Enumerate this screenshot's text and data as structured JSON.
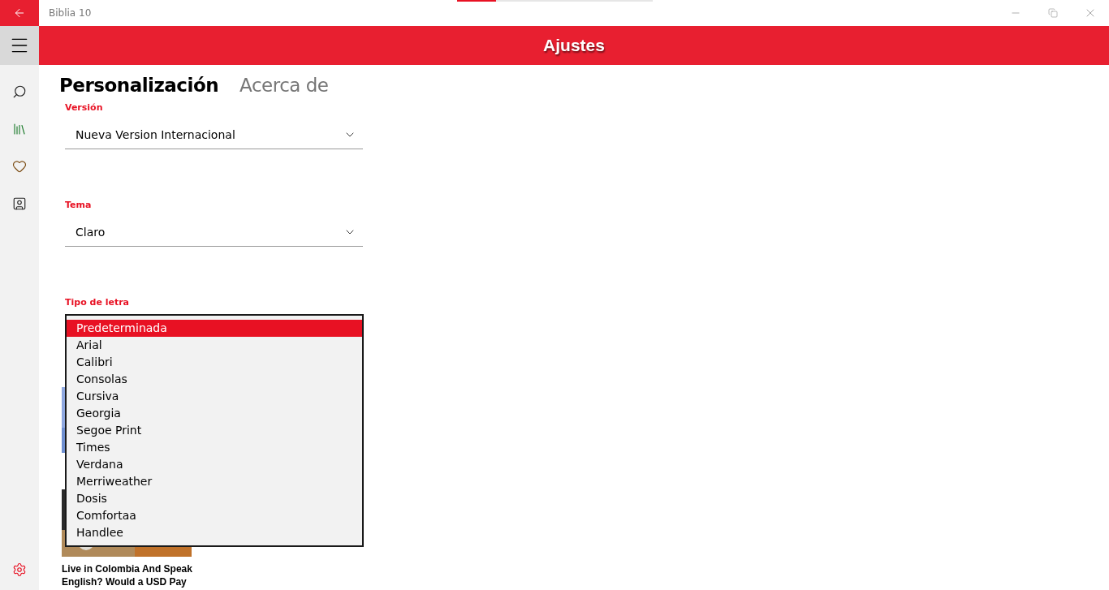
{
  "window": {
    "title": "Biblia 10"
  },
  "loading_bar": {
    "level": 0.2
  },
  "header": {
    "title": "Ajustes"
  },
  "tabs": [
    {
      "label": "Personalización",
      "selected": true
    },
    {
      "label": "Acerca de",
      "selected": false
    }
  ],
  "settings": [
    {
      "kind": "combo",
      "label": "Versión",
      "value": "Nueva Version Internacional"
    },
    {
      "kind": "combo",
      "label": "Tema",
      "value": "Claro"
    },
    {
      "kind": "list",
      "label": "Tipo de letra",
      "options": [
        {
          "label": "Predeterminada",
          "selected": true
        },
        {
          "label": "Arial",
          "selected": false
        },
        {
          "label": "Calibri",
          "selected": false
        },
        {
          "label": "Consolas",
          "selected": false
        },
        {
          "label": "Cursiva",
          "selected": false
        },
        {
          "label": "Georgia",
          "selected": false
        },
        {
          "label": "Segoe Print",
          "selected": false
        },
        {
          "label": "Times",
          "selected": false
        },
        {
          "label": "Verdana",
          "selected": false
        },
        {
          "label": "Merriweather",
          "selected": false
        },
        {
          "label": "Dosis",
          "selected": false
        },
        {
          "label": "Comfortaa",
          "selected": false
        },
        {
          "label": "Handlee",
          "selected": false
        }
      ]
    }
  ],
  "ad": {
    "headline": "Live in Colombia And Speak English? Would a USD Pay"
  }
}
